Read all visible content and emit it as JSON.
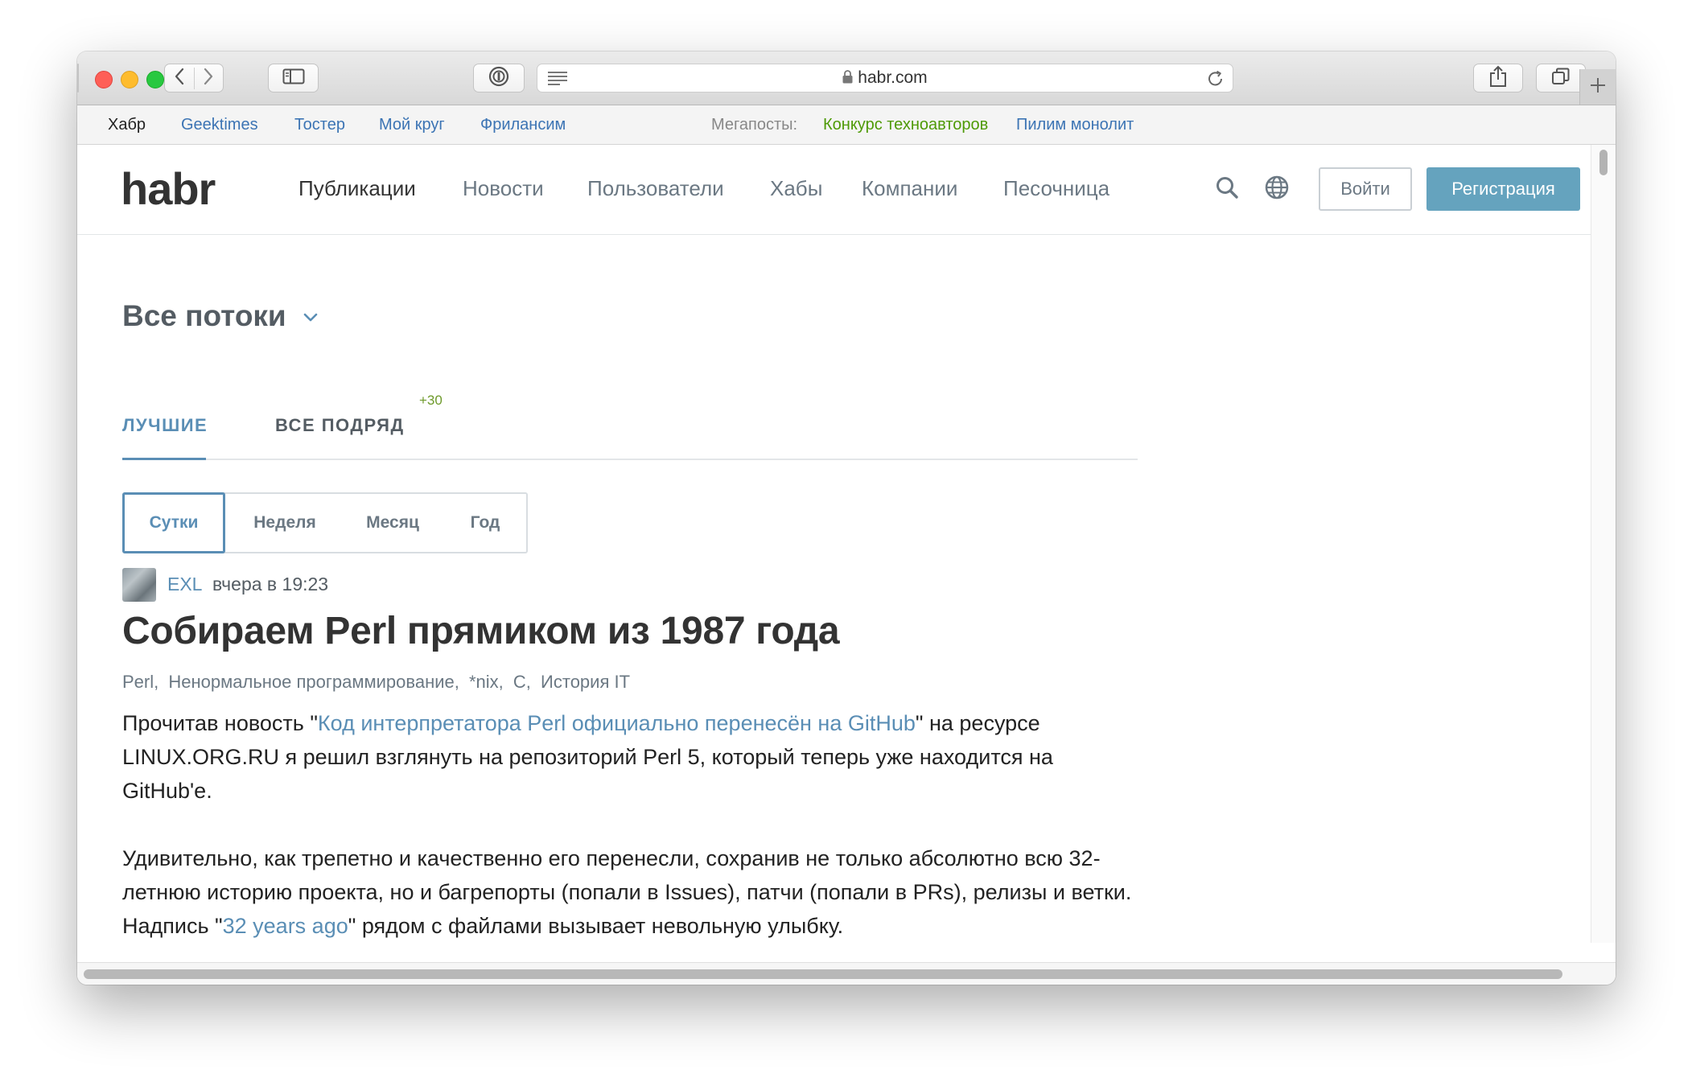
{
  "browser": {
    "address": "habr.com",
    "icons": [
      "back-icon",
      "forward-icon",
      "sidebar-icon",
      "password-icon",
      "reader-icon",
      "lock-icon",
      "reload-icon",
      "share-icon",
      "tabs-icon",
      "new-tab-icon"
    ]
  },
  "favorites": {
    "items": [
      "Хабр",
      "Geektimes",
      "Тостер",
      "Мой круг",
      "Фрилансим"
    ],
    "megaposts_label": "Мегапосты:",
    "megaposts": [
      {
        "label": "Конкурс техноавторов",
        "color": "#4e9a06"
      },
      {
        "label": "Пилим монолит",
        "color": "#3c74b4"
      }
    ]
  },
  "site": {
    "logo": "habr",
    "nav": [
      "Публикации",
      "Новости",
      "Пользователи",
      "Хабы",
      "Компании",
      "Песочница"
    ],
    "login": "Войти",
    "register": "Регистрация",
    "accent": "#65a3be"
  },
  "stream": {
    "title": "Все потоки",
    "tabs": [
      {
        "label": "ЛУЧШИЕ",
        "active": true
      },
      {
        "label": "ВСЕ ПОДРЯД",
        "count": "+30"
      }
    ],
    "periods": [
      "Сутки",
      "Неделя",
      "Месяц",
      "Год"
    ],
    "active_period": "Сутки"
  },
  "post": {
    "author": "EXL",
    "time": "вчера в 19:23",
    "title": "Собираем Perl прямиком из 1987 года",
    "hubs": [
      "Perl,",
      "Ненормальное программирование,",
      "*nix,",
      "C,",
      "История IT"
    ],
    "p1": {
      "before": "Прочитав новость \"",
      "link": "Код интерпретатора Perl официально перенесён на GitHub",
      "after": "\" на ресурсе LINUX.ORG.RU я решил взглянуть на репозиторий Perl 5, который теперь уже находится на GitHub'е."
    },
    "p2": {
      "before": "Удивительно, как трепетно и качественно его перенесли, сохранив не только абсолютно всю 32-летнюю историю проекта, но и багрепорты (попали в Issues), патчи (попали в PRs), релизы и ветки. Надпись \"",
      "link": "32 years ago",
      "after": "\" рядом с файлами вызывает невольную улыбку."
    }
  }
}
